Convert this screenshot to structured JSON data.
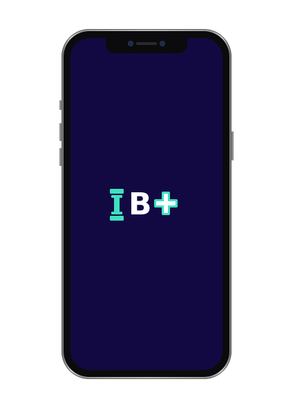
{
  "device": {
    "model_shape": "iphone-x",
    "screen_background": "#130942",
    "frame_color": "#bcbcbc"
  },
  "splash": {
    "logo": {
      "letter": "B",
      "icons": [
        "dumbbell-icon",
        "plus-icon"
      ],
      "accent_color": "#3ee0c0",
      "letter_color": "#ffffff"
    }
  }
}
